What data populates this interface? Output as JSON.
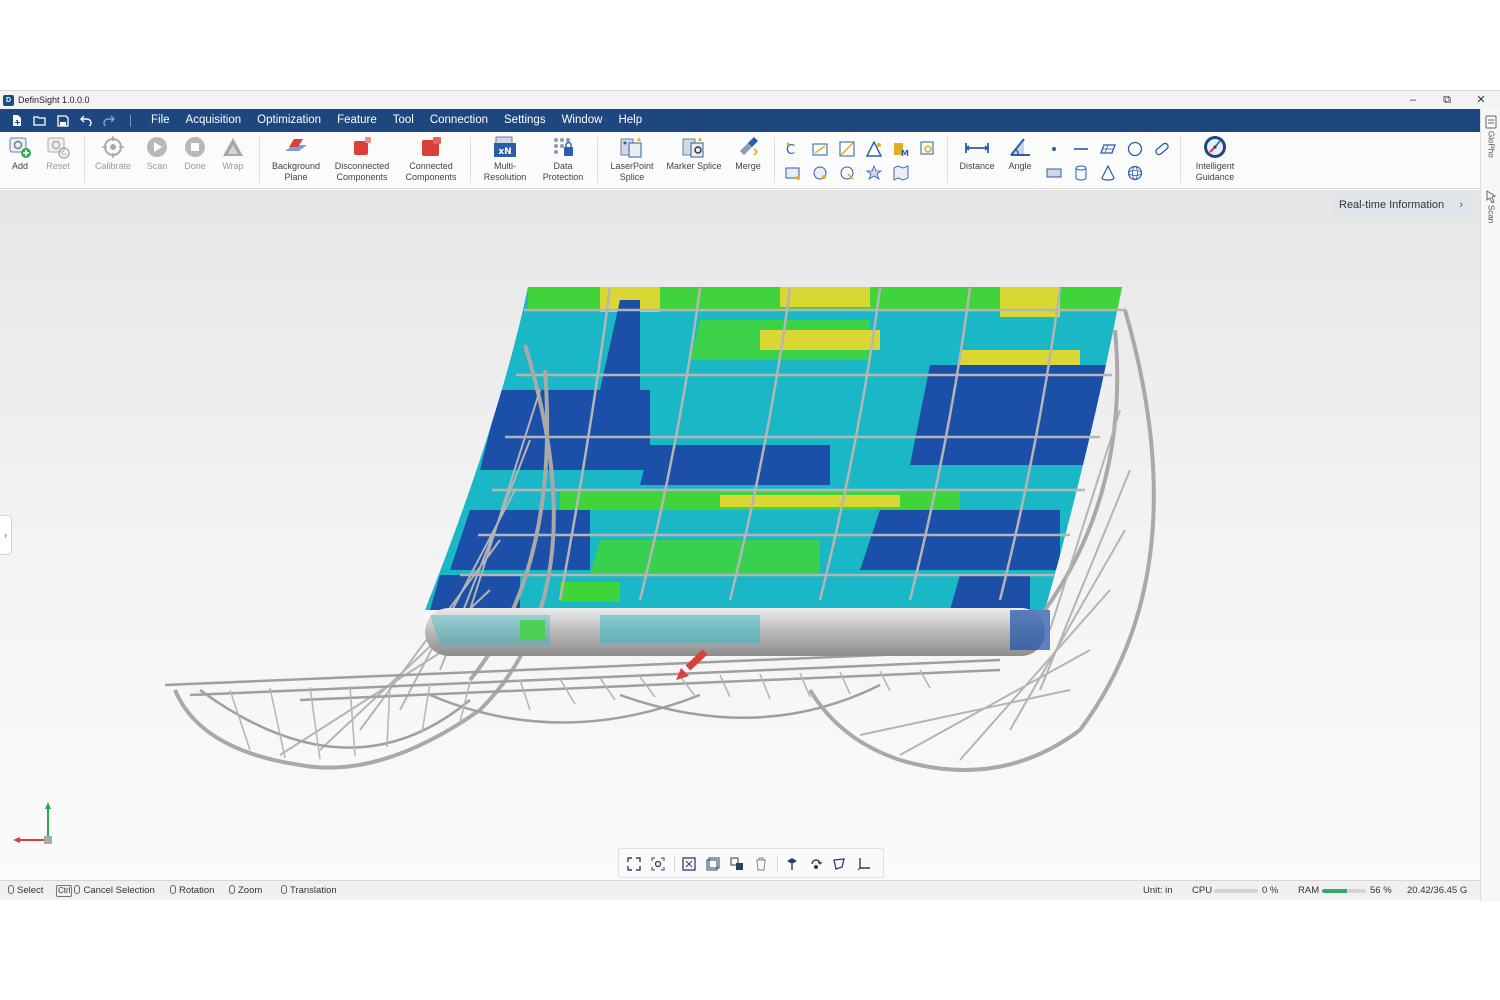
{
  "window": {
    "title": "DefinSight 1.0.0.0",
    "controls": [
      "–",
      "⧉",
      "✕"
    ]
  },
  "menu": [
    "File",
    "Acquisition",
    "Optimization",
    "Feature",
    "Tool",
    "Connection",
    "Settings",
    "Window",
    "Help"
  ],
  "ribbon": {
    "acquisition": [
      {
        "label": "Add",
        "icon": "add-scan-icon",
        "enabled": true
      },
      {
        "label": "Reset",
        "icon": "reset-icon",
        "enabled": false
      },
      {
        "label": "Calibrate",
        "icon": "calibrate-icon",
        "enabled": false
      },
      {
        "label": "Scan",
        "icon": "scan-icon",
        "enabled": false
      },
      {
        "label": "Done",
        "icon": "done-icon",
        "enabled": false
      },
      {
        "label": "Wrap",
        "icon": "wrap-icon",
        "enabled": false
      }
    ],
    "optimization": [
      {
        "label": "Background Plane",
        "icon": "background-plane-icon"
      },
      {
        "label": "Disconnected Components",
        "icon": "disconnected-components-icon"
      },
      {
        "label": "Connected Components",
        "icon": "connected-components-icon"
      },
      {
        "label": "Multi-Resolution",
        "icon": "multi-resolution-icon",
        "badge": "×N"
      },
      {
        "label": "Data Protection",
        "icon": "data-protection-icon"
      },
      {
        "label": "LaserPoint Splice",
        "icon": "laserpoint-splice-icon"
      },
      {
        "label": "Marker Splice",
        "icon": "marker-splice-icon"
      },
      {
        "label": "Merge",
        "icon": "merge-icon"
      }
    ],
    "measure": [
      {
        "label": "Distance",
        "icon": "distance-icon"
      },
      {
        "label": "Angle",
        "icon": "angle-icon"
      }
    ],
    "guidance": {
      "label": "Intelligent Guidance",
      "icon": "intelligent-guidance-icon"
    }
  },
  "side_tabs": [
    "GloPho",
    "Scan"
  ],
  "viewport": {
    "realtime_button": "Real-time Information",
    "side_toggle": "›"
  },
  "status": {
    "select": "Select",
    "ctrl_key": "Ctrl",
    "cancel_selection": "Cancel Selection",
    "rotation": "Rotation",
    "zoom": "Zoom",
    "translation": "Translation",
    "unit": "Unit: in",
    "cpu_label": "CPU",
    "cpu_value": "0 %",
    "cpu_fraction": 0.0,
    "ram_label": "RAM",
    "ram_value": "56 %",
    "ram_fraction": 0.56,
    "memory": "20.42/36.45 G"
  },
  "colors": {
    "menubar": "#1e4780",
    "accent_red": "#d9403a",
    "accent_blue": "#2a5fa8",
    "deviation_blue": "#1c4fa8",
    "deviation_cyan": "#1ab8c6",
    "deviation_green": "#3fd43a",
    "deviation_yellow": "#d9d734"
  }
}
